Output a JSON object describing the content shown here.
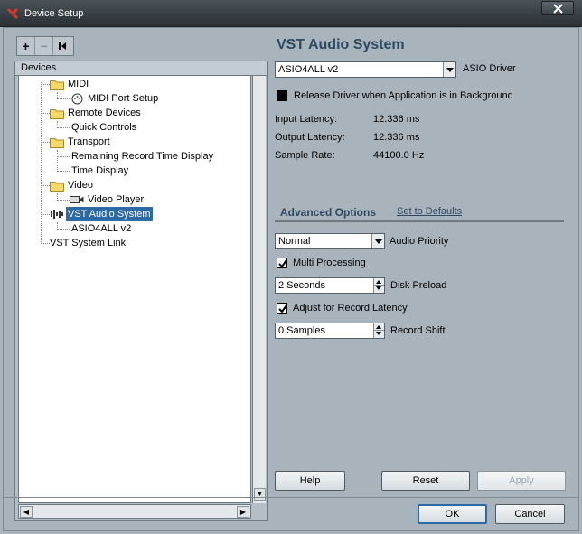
{
  "window": {
    "title": "Device Setup",
    "icon": "cubase-logo-icon",
    "close_icon": "close-icon"
  },
  "toolbar": {
    "add_label": "+",
    "remove_label": "−",
    "reset_label": "⏮"
  },
  "tree": {
    "header": "Devices",
    "nodes": [
      {
        "label": "MIDI",
        "icon": "folder-icon"
      },
      {
        "label": "MIDI Port Setup",
        "icon": "midi-port-icon"
      },
      {
        "label": "Remote Devices",
        "icon": "folder-icon"
      },
      {
        "label": "Quick Controls",
        "icon": ""
      },
      {
        "label": "Transport",
        "icon": "folder-icon"
      },
      {
        "label": "Remaining Record Time Display",
        "icon": ""
      },
      {
        "label": "Time Display",
        "icon": ""
      },
      {
        "label": "Video",
        "icon": "folder-icon"
      },
      {
        "label": "Video Player",
        "icon": "video-player-icon"
      },
      {
        "label": "VST Audio System",
        "icon": "audio-system-icon"
      },
      {
        "label": "ASIO4ALL v2",
        "icon": ""
      },
      {
        "label": "VST System Link",
        "icon": ""
      }
    ],
    "selected": "VST Audio System"
  },
  "panel": {
    "title": "VST Audio System",
    "driver_value": "ASIO4ALL v2",
    "driver_label": "ASIO Driver",
    "release_label": "Release Driver when Application is in Background",
    "release_checked": false,
    "input_latency_label": "Input Latency:",
    "input_latency_value": "12.336 ms",
    "output_latency_label": "Output Latency:",
    "output_latency_value": "12.336 ms",
    "sample_rate_label": "Sample Rate:",
    "sample_rate_value": "44100.0 Hz"
  },
  "advanced": {
    "tab_label": "Advanced Options",
    "defaults_label": "Set to Defaults",
    "priority_value": "Normal",
    "priority_label": "Audio Priority",
    "multi_label": "Multi Processing",
    "multi_checked": true,
    "preload_value": "2 Seconds",
    "preload_label": "Disk Preload",
    "adjust_label": "Adjust for Record Latency",
    "adjust_checked": true,
    "shift_value": "0 Samples",
    "shift_label": "Record Shift"
  },
  "buttons": {
    "help": "Help",
    "reset": "Reset",
    "apply": "Apply",
    "ok": "OK",
    "cancel": "Cancel"
  },
  "colors": {
    "background": "#a9b3bb",
    "accent": "#2e4a62",
    "selection": "#2d6aa5",
    "titlebar": "#2a3034"
  }
}
